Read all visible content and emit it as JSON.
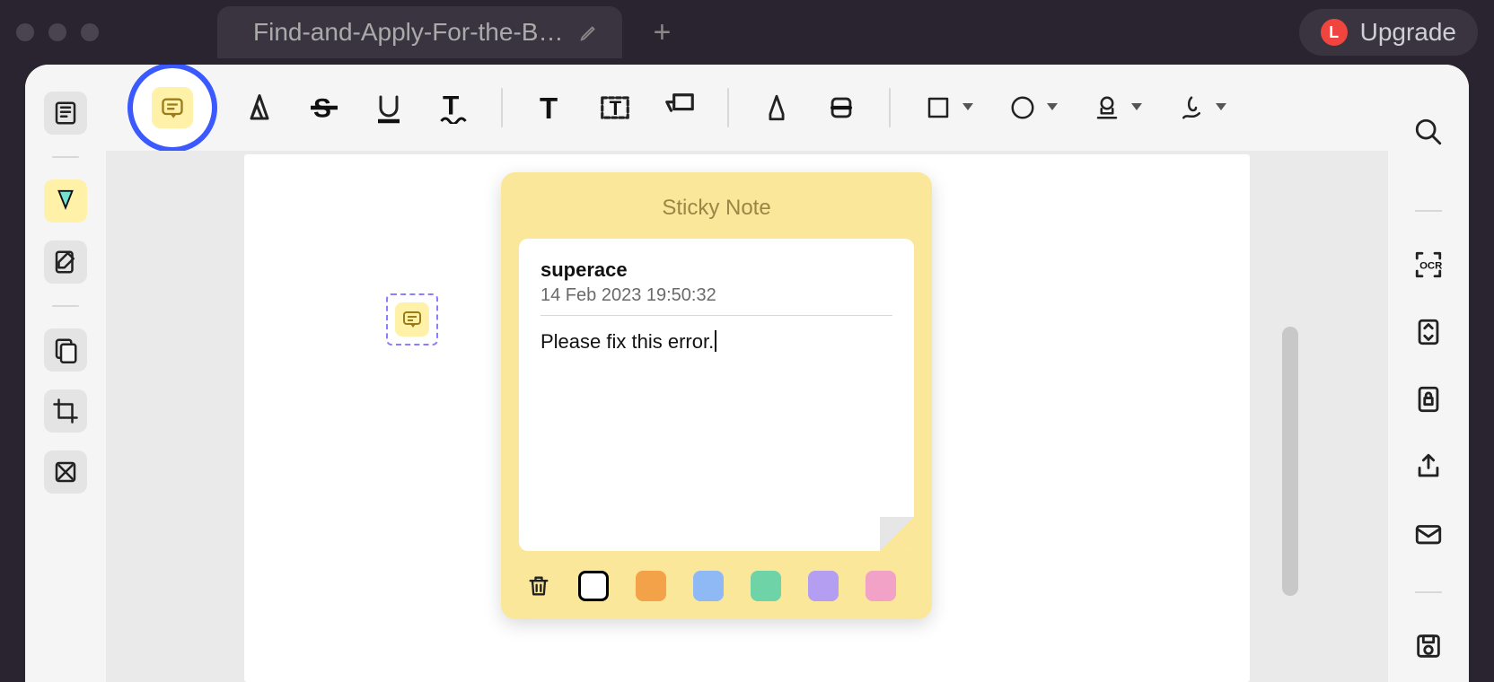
{
  "window": {
    "tab_title": "Find-and-Apply-For-the-B…",
    "upgrade_label": "Upgrade",
    "avatar_letter": "L"
  },
  "left_rail": {
    "items": [
      {
        "name": "thumbnails",
        "active": false
      },
      {
        "name": "annotations",
        "active": true
      },
      {
        "name": "edit-page",
        "active": false
      },
      {
        "name": "pages-panel",
        "active": false
      },
      {
        "name": "crop",
        "active": false
      },
      {
        "name": "redact",
        "active": false
      }
    ]
  },
  "toolbar": {
    "note": "Note",
    "highlight": "Highlight",
    "strike": "Strikethrough",
    "underline": "Underline",
    "squiggly": "Squiggly",
    "text_style": "Text",
    "text_box": "Text Box",
    "callout": "Callout",
    "pencil": "Pencil",
    "eraser": "Eraser",
    "shape": "Shape",
    "circle": "Oval",
    "stamp": "Stamp",
    "signature": "Signature"
  },
  "sticky_note": {
    "title": "Sticky Note",
    "author": "superace",
    "timestamp": "14 Feb 2023 19:50:32",
    "content": "Please fix this error.",
    "colors": [
      "#ffffff",
      "#f3a24a",
      "#8fb9f5",
      "#6fd3a8",
      "#b39ef2",
      "#f2a2c7"
    ],
    "selected_color": 0
  },
  "right_rail": {
    "search": "Search",
    "ocr": "OCR",
    "convert": "Convert",
    "secure": "Protect",
    "share": "Share",
    "email": "Email",
    "save": "Save"
  }
}
